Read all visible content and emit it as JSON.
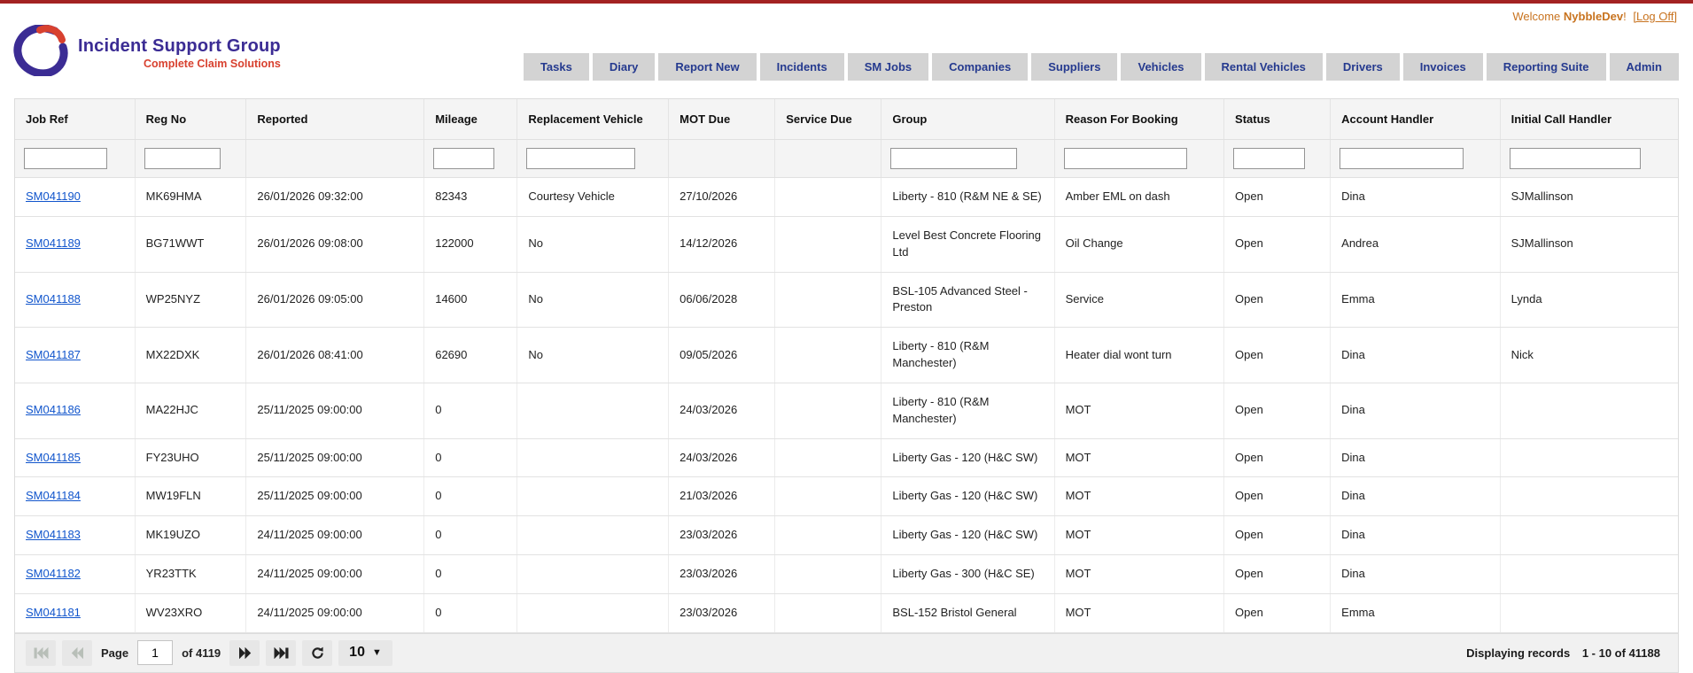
{
  "header": {
    "welcome_prefix": "Welcome",
    "username": "NybbleDev",
    "welcome_suffix": "!",
    "logoff_label": "[Log Off]"
  },
  "logo": {
    "title": "Incident Support Group",
    "subtitle": "Complete Claim Solutions",
    "purple": "#3b2c94",
    "red": "#d8412f"
  },
  "nav": {
    "tabs": [
      "Tasks",
      "Diary",
      "Report New",
      "Incidents",
      "SM Jobs",
      "Companies",
      "Suppliers",
      "Vehicles",
      "Rental Vehicles",
      "Drivers",
      "Invoices",
      "Reporting Suite",
      "Admin"
    ]
  },
  "table": {
    "field_order": [
      "job_ref",
      "reg_no",
      "reported",
      "mileage",
      "replacement_vehicle",
      "mot_due",
      "service_due",
      "group",
      "reason_for_booking",
      "status",
      "account_handler",
      "initial_call_handler"
    ],
    "columns": [
      {
        "label": "Job Ref",
        "filter": true
      },
      {
        "label": "Reg No",
        "filter": true
      },
      {
        "label": "Reported",
        "filter": false
      },
      {
        "label": "Mileage",
        "filter": true
      },
      {
        "label": "Replacement Vehicle",
        "filter": true
      },
      {
        "label": "MOT Due",
        "filter": false
      },
      {
        "label": "Service Due",
        "filter": false
      },
      {
        "label": "Group",
        "filter": true
      },
      {
        "label": "Reason For Booking",
        "filter": true
      },
      {
        "label": "Status",
        "filter": true
      },
      {
        "label": "Account Handler",
        "filter": true
      },
      {
        "label": "Initial Call Handler",
        "filter": true
      }
    ],
    "rows": [
      {
        "job_ref": "SM041190",
        "reg_no": "MK69HMA",
        "reported": "26/01/2026 09:32:00",
        "mileage": "82343",
        "replacement_vehicle": "Courtesy Vehicle",
        "mot_due": "27/10/2026",
        "service_due": "",
        "group": "Liberty - 810 (R&M NE & SE)",
        "reason_for_booking": "Amber EML on dash",
        "status": "Open",
        "account_handler": "Dina",
        "initial_call_handler": "SJMallinson"
      },
      {
        "job_ref": "SM041189",
        "reg_no": "BG71WWT",
        "reported": "26/01/2026 09:08:00",
        "mileage": "122000",
        "replacement_vehicle": "No",
        "mot_due": "14/12/2026",
        "service_due": "",
        "group": "Level Best Concrete Flooring Ltd",
        "reason_for_booking": "Oil Change",
        "status": "Open",
        "account_handler": "Andrea",
        "initial_call_handler": "SJMallinson"
      },
      {
        "job_ref": "SM041188",
        "reg_no": "WP25NYZ",
        "reported": "26/01/2026 09:05:00",
        "mileage": "14600",
        "replacement_vehicle": "No",
        "mot_due": "06/06/2028",
        "service_due": "",
        "group": "BSL-105 Advanced Steel - Preston",
        "reason_for_booking": "Service",
        "status": "Open",
        "account_handler": "Emma",
        "initial_call_handler": "Lynda"
      },
      {
        "job_ref": "SM041187",
        "reg_no": "MX22DXK",
        "reported": "26/01/2026 08:41:00",
        "mileage": "62690",
        "replacement_vehicle": "No",
        "mot_due": "09/05/2026",
        "service_due": "",
        "group": "Liberty - 810 (R&M Manchester)",
        "reason_for_booking": "Heater dial wont turn",
        "status": "Open",
        "account_handler": "Dina",
        "initial_call_handler": "Nick"
      },
      {
        "job_ref": "SM041186",
        "reg_no": "MA22HJC",
        "reported": "25/11/2025 09:00:00",
        "mileage": "0",
        "replacement_vehicle": "",
        "mot_due": "24/03/2026",
        "service_due": "",
        "group": "Liberty - 810 (R&M Manchester)",
        "reason_for_booking": "MOT",
        "status": "Open",
        "account_handler": "Dina",
        "initial_call_handler": ""
      },
      {
        "job_ref": "SM041185",
        "reg_no": "FY23UHO",
        "reported": "25/11/2025 09:00:00",
        "mileage": "0",
        "replacement_vehicle": "",
        "mot_due": "24/03/2026",
        "service_due": "",
        "group": "Liberty Gas - 120 (H&C SW)",
        "reason_for_booking": "MOT",
        "status": "Open",
        "account_handler": "Dina",
        "initial_call_handler": ""
      },
      {
        "job_ref": "SM041184",
        "reg_no": "MW19FLN",
        "reported": "25/11/2025 09:00:00",
        "mileage": "0",
        "replacement_vehicle": "",
        "mot_due": "21/03/2026",
        "service_due": "",
        "group": "Liberty Gas - 120 (H&C SW)",
        "reason_for_booking": "MOT",
        "status": "Open",
        "account_handler": "Dina",
        "initial_call_handler": ""
      },
      {
        "job_ref": "SM041183",
        "reg_no": "MK19UZO",
        "reported": "24/11/2025 09:00:00",
        "mileage": "0",
        "replacement_vehicle": "",
        "mot_due": "23/03/2026",
        "service_due": "",
        "group": "Liberty Gas - 120 (H&C SW)",
        "reason_for_booking": "MOT",
        "status": "Open",
        "account_handler": "Dina",
        "initial_call_handler": ""
      },
      {
        "job_ref": "SM041182",
        "reg_no": "YR23TTK",
        "reported": "24/11/2025 09:00:00",
        "mileage": "0",
        "replacement_vehicle": "",
        "mot_due": "23/03/2026",
        "service_due": "",
        "group": "Liberty Gas - 300 (H&C SE)",
        "reason_for_booking": "MOT",
        "status": "Open",
        "account_handler": "Dina",
        "initial_call_handler": ""
      },
      {
        "job_ref": "SM041181",
        "reg_no": "WV23XRO",
        "reported": "24/11/2025 09:00:00",
        "mileage": "0",
        "replacement_vehicle": "",
        "mot_due": "23/03/2026",
        "service_due": "",
        "group": "BSL-152 Bristol General",
        "reason_for_booking": "MOT",
        "status": "Open",
        "account_handler": "Emma",
        "initial_call_handler": ""
      }
    ]
  },
  "pager": {
    "page_label": "Page",
    "current_page": "1",
    "of_label": "of 4119",
    "page_size": "10",
    "records_label": "Displaying records",
    "records_value": "1 - 10 of 41188",
    "icons": [
      "first-page-icon",
      "prev-page-icon",
      "next-page-icon",
      "last-page-icon",
      "refresh-icon",
      "caret-down-icon"
    ]
  },
  "colors": {
    "top_strip": "#a32222",
    "welcome_text": "#c8731f",
    "nav_tab_bg": "#d3d3d3",
    "nav_tab_text": "#253a8f",
    "link_blue": "#1155cc",
    "header_bg": "#f4f4f4",
    "footer_bg": "#f1f1f1"
  }
}
